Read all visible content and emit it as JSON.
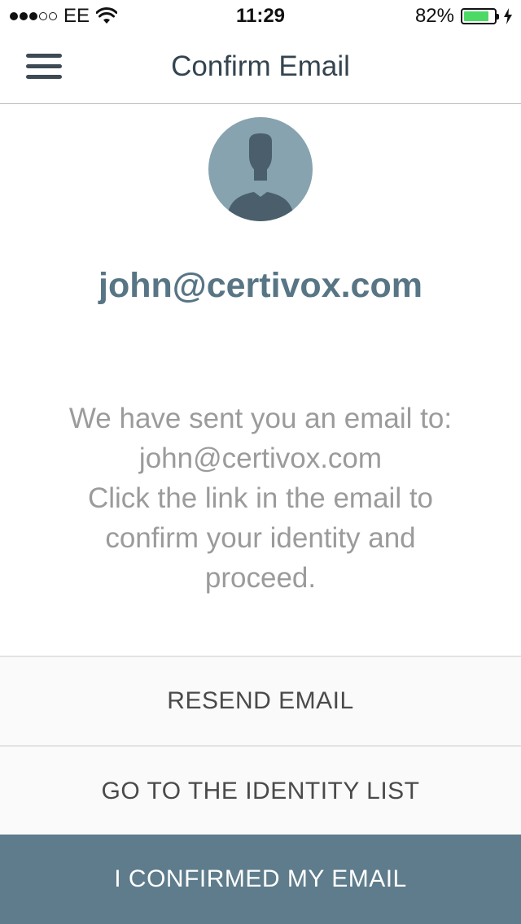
{
  "status_bar": {
    "carrier": "EE",
    "time": "11:29",
    "battery_percent_label": "82%",
    "battery_level": 0.82,
    "signal_filled": 3,
    "signal_total": 5,
    "battery_color": "#4cd964"
  },
  "navbar": {
    "title": "Confirm Email",
    "menu_icon": "hamburger-menu-icon"
  },
  "profile": {
    "avatar_icon": "user-silhouette-icon",
    "email": "john@certivox.com"
  },
  "message": {
    "lines": [
      "We have sent you an email to:",
      "john@certivox.com",
      "Click the link in the email to",
      "confirm your identity and",
      "proceed."
    ]
  },
  "actions": {
    "resend_label": "RESEND EMAIL",
    "identity_list_label": "GO TO THE IDENTITY LIST",
    "confirmed_label": "I CONFIRMED MY EMAIL"
  },
  "colors": {
    "primary": "#5e7c8b",
    "email_text": "#587585",
    "avatar_bg": "#86a3af",
    "avatar_figure": "#4a5f6b"
  }
}
